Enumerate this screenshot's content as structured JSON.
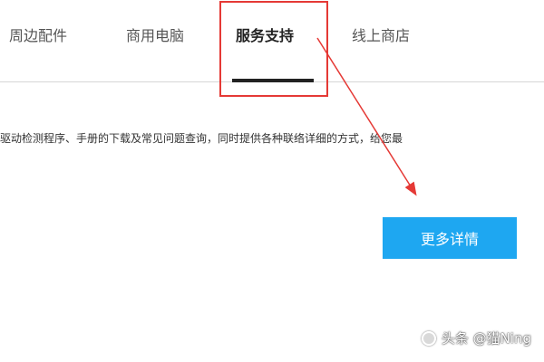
{
  "nav": {
    "tabs": [
      {
        "label": "周边配件"
      },
      {
        "label": "商用电脑"
      },
      {
        "label": "服务支持"
      },
      {
        "label": "线上商店"
      }
    ],
    "active_tab": "服务支持"
  },
  "main": {
    "description": "驱动检测程序、手册的下载及常见问题查询，同时提供各种联络详细的方式，给您最",
    "more_button_label": "更多详情"
  },
  "annotation": {
    "highlight_color": "#e53935"
  },
  "watermark": {
    "text": "头条 @猫Ning"
  },
  "colors": {
    "accent": "#1ea7f1",
    "text": "#333333"
  }
}
